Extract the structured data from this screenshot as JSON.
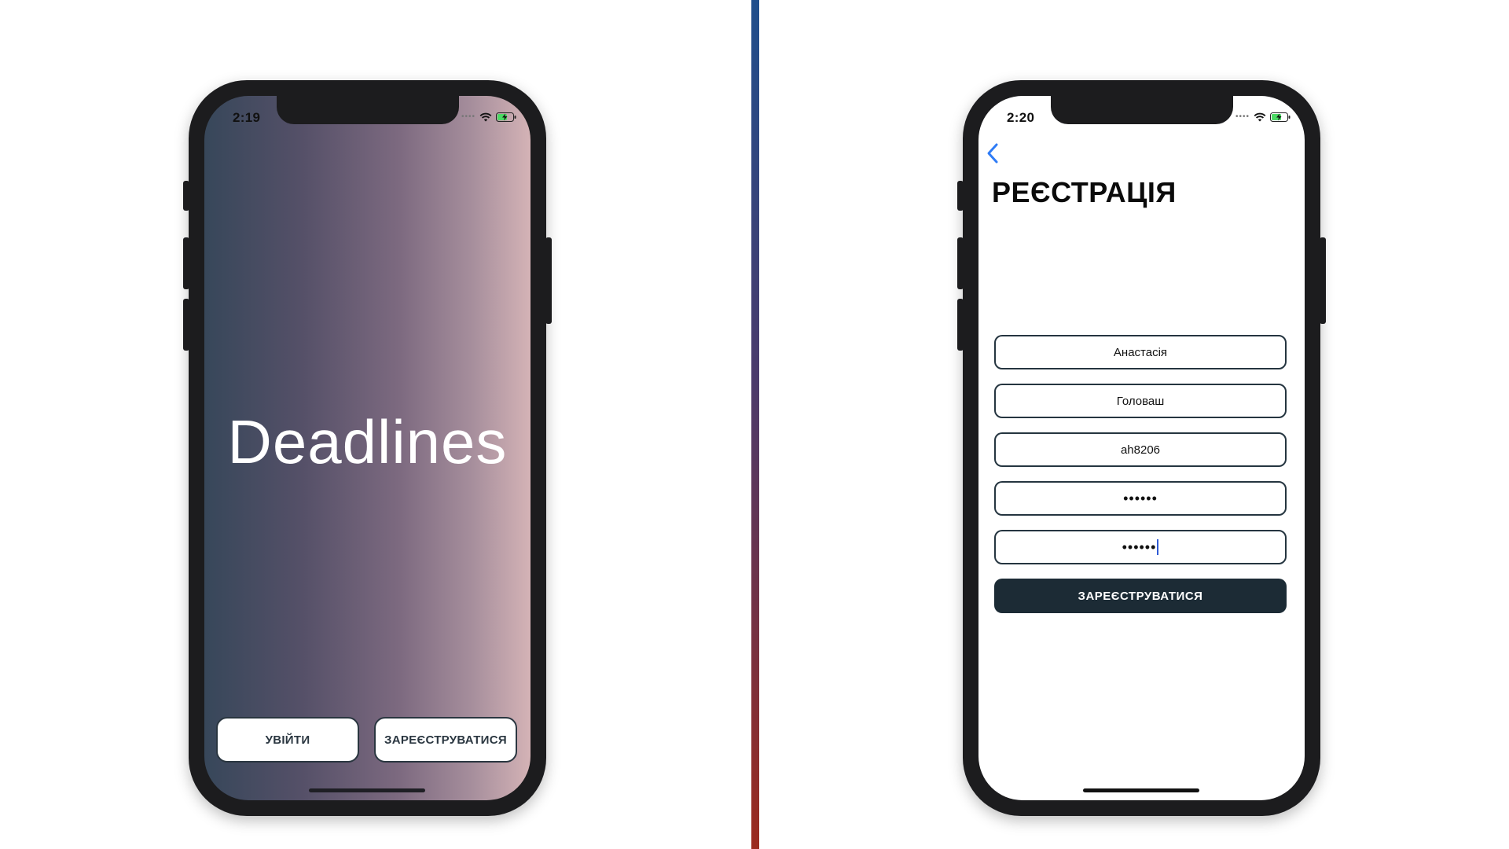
{
  "welcome_screen": {
    "status_time": "2:19",
    "app_title": "Deadlines",
    "login_button": "УВІЙТИ",
    "register_button": "ЗАРЕЄСТРУВАТИСЯ",
    "gradient_colors": [
      "#37475a",
      "#7d6a80",
      "#d4b3b6"
    ]
  },
  "register_screen": {
    "status_time": "2:20",
    "title": "РЕЄСТРАЦІЯ",
    "fields": {
      "first_name": "Анастасія",
      "last_name": "Головаш",
      "username": "ah8206",
      "password": "••••••",
      "password_confirm": "••••••"
    },
    "submit_button": "ЗАРЕЄСТРУВАТИСЯ",
    "accent_color": "#2f7cf6",
    "button_color": "#1c2b35"
  },
  "icons": {
    "wifi": "wifi-icon",
    "battery": "battery-charging-icon",
    "signal": "cellular-signal-icon",
    "back": "chevron-left-icon"
  }
}
